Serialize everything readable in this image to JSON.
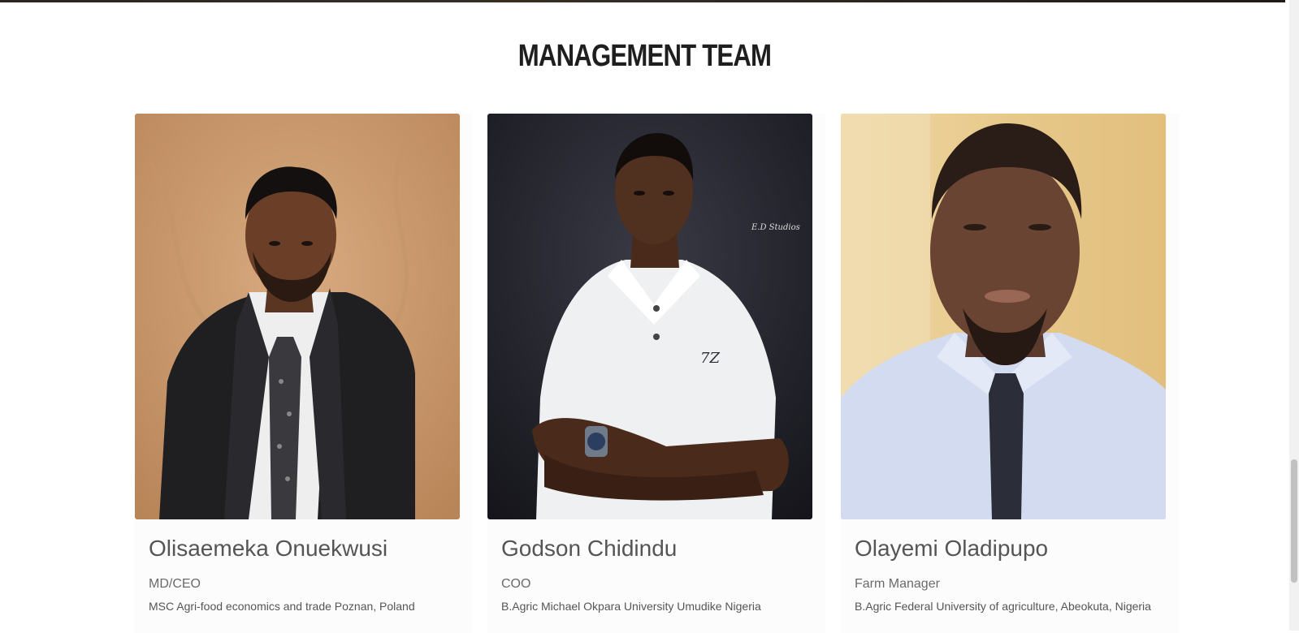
{
  "section": {
    "title": "MANAGEMENT TEAM"
  },
  "team": [
    {
      "name": "Olisaemeka Onuekwusi",
      "role": "MD/CEO",
      "education": "MSC Agri-food economics and trade Poznan, Poland",
      "photo_background": "#c9986d"
    },
    {
      "name": "Godson Chidindu",
      "role": "COO",
      "education": "B.Agric Michael Okpara University Umudike Nigeria",
      "photo_background": "#23232b",
      "photo_watermark": "E.D Studios",
      "shirt_logo": "7Z"
    },
    {
      "name": "Olayemi Oladipupo",
      "role": "Farm Manager",
      "education": "B.Agric Federal University of agriculture, Abeokuta, Nigeria",
      "photo_background": "#e8c983"
    }
  ]
}
